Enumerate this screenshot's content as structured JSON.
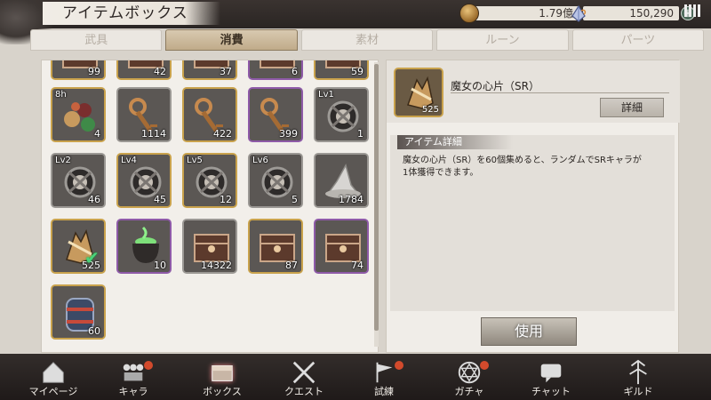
{
  "header": {
    "title": "アイテムボックス",
    "gold": "1.79億",
    "gems": "150,290",
    "plus": "+"
  },
  "tabs": [
    {
      "label": "武具",
      "active": false
    },
    {
      "label": "消費",
      "active": true
    },
    {
      "label": "素材",
      "active": false
    },
    {
      "label": "ルーン",
      "active": false
    },
    {
      "label": "パーツ",
      "active": false
    }
  ],
  "grid": {
    "partial_row": [
      "99",
      "42",
      "37",
      "6",
      "59"
    ],
    "rows": [
      [
        {
          "lv": "8h",
          "count": "4",
          "icon": "orbs-icon",
          "rarity": "gold"
        },
        {
          "lv": "",
          "count": "1114",
          "icon": "key-icon",
          "rarity": "silver"
        },
        {
          "lv": "",
          "count": "422",
          "icon": "key-icon",
          "rarity": "gold"
        },
        {
          "lv": "",
          "count": "399",
          "icon": "key-icon",
          "rarity": "purple"
        },
        {
          "lv": "Lv1",
          "count": "1",
          "icon": "medal-icon",
          "rarity": "silver"
        }
      ],
      [
        {
          "lv": "Lv2",
          "count": "46",
          "icon": "medal-icon",
          "rarity": "silver"
        },
        {
          "lv": "Lv4",
          "count": "45",
          "icon": "medal-icon",
          "rarity": "gold"
        },
        {
          "lv": "Lv5",
          "count": "12",
          "icon": "medal-icon",
          "rarity": "gold"
        },
        {
          "lv": "Lv6",
          "count": "5",
          "icon": "medal-icon",
          "rarity": "silver"
        },
        {
          "lv": "",
          "count": "1784",
          "icon": "witch-hat-icon",
          "rarity": "silver"
        }
      ],
      [
        {
          "lv": "",
          "count": "525",
          "icon": "witch-shard-icon",
          "rarity": "gold",
          "selected": true
        },
        {
          "lv": "",
          "count": "10",
          "icon": "cauldron-icon",
          "rarity": "purple"
        },
        {
          "lv": "",
          "count": "14322",
          "icon": "chest-icon",
          "rarity": "silver"
        },
        {
          "lv": "",
          "count": "87",
          "icon": "chest-icon",
          "rarity": "gold"
        },
        {
          "lv": "",
          "count": "74",
          "icon": "chest-icon",
          "rarity": "purple"
        }
      ],
      [
        {
          "lv": "",
          "count": "60",
          "icon": "barrel-icon",
          "rarity": "gold"
        }
      ]
    ]
  },
  "detail": {
    "name": "魔女の心片（SR）",
    "count": "525",
    "detail_button": "詳細",
    "info_title": "アイテム詳細",
    "info_text_1": "魔女の心片（SR）を60個集めると、ランダムでSRキャラが",
    "info_text_2": "1体獲得できます。",
    "use_button": "使用"
  },
  "nav": [
    {
      "label": "マイページ",
      "icon": "home-icon",
      "badge": false
    },
    {
      "label": "キャラ",
      "icon": "characters-icon",
      "badge": true
    },
    {
      "label": "ボックス",
      "icon": "box-icon",
      "badge": false,
      "active": true
    },
    {
      "label": "クエスト",
      "icon": "swords-icon",
      "badge": false
    },
    {
      "label": "試練",
      "icon": "flag-icon",
      "badge": true
    },
    {
      "label": "ガチャ",
      "icon": "hexagram-icon",
      "badge": true
    },
    {
      "label": "チャット",
      "icon": "chat-icon",
      "badge": false
    },
    {
      "label": "ギルド",
      "icon": "guild-icon",
      "badge": false
    }
  ],
  "colors": {
    "gold": "#c9a24c",
    "purple": "#8e5aa8",
    "silver": "#9b9894",
    "badge": "#d24a2c"
  }
}
